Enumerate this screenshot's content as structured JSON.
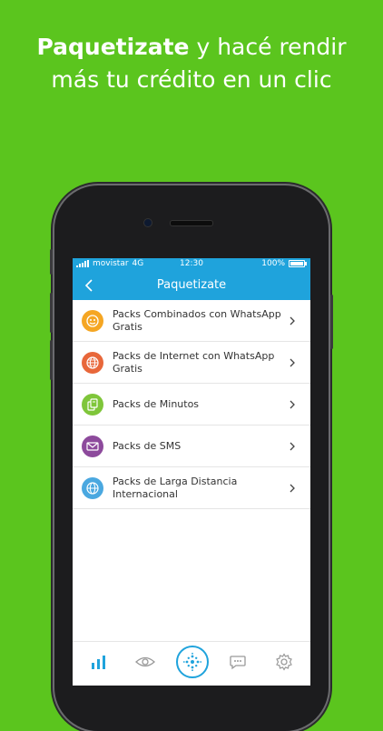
{
  "headline": {
    "bold": "Paquetizate",
    "rest_line1": " y hacé rendir",
    "line2": "más tu crédito en un clic"
  },
  "status_bar": {
    "carrier": "movistar",
    "network": "4G",
    "time": "12:30",
    "battery": "100%"
  },
  "nav": {
    "title": "Paquetizate"
  },
  "packs": [
    {
      "label": "Packs Combinados con WhatsApp Gratis",
      "icon": "combo-icon",
      "color": "#f5a623"
    },
    {
      "label": "Packs de Internet con WhatsApp Gratis",
      "icon": "globe-icon",
      "color": "#e8673a"
    },
    {
      "label": "Packs de Minutos",
      "icon": "phone-minutes-icon",
      "color": "#7fc63a"
    },
    {
      "label": "Packs de SMS",
      "icon": "envelope-icon",
      "color": "#8d4a9c"
    },
    {
      "label": "Packs de Larga Distancia Internacional",
      "icon": "world-icon",
      "color": "#4aa8e0"
    }
  ],
  "colors": {
    "background": "#5bc51e",
    "accent": "#1fa3dc",
    "phone_body": "#1c1c1e"
  },
  "tabbar": {
    "tabs": [
      "stats-icon",
      "eye-icon",
      "home-logo-icon",
      "chat-icon",
      "settings-icon"
    ],
    "active": "stats-icon"
  }
}
